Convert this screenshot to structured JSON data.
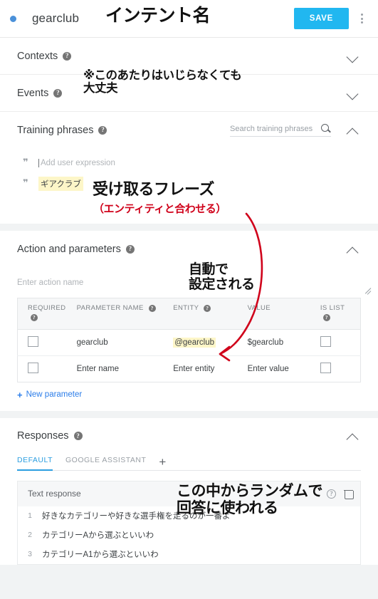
{
  "header": {
    "agent_name": "gearclub",
    "save_label": "SAVE",
    "dot_color": "#4a90d9",
    "save_color": "#21b7f0",
    "menu_icon": "more-vert-icon"
  },
  "sections": {
    "contexts": {
      "title": "Contexts",
      "chevron": "chevron-down-icon"
    },
    "events": {
      "title": "Events",
      "chevron": "chevron-down-icon"
    },
    "training_phrases": {
      "title": "Training phrases",
      "chevron": "chevron-up-icon",
      "search_placeholder": "Search training phrases",
      "search_value": "",
      "add_placeholder": "Add user expression",
      "phrases": [
        {
          "text": "ギアクラブ",
          "highlight": "#fdf6c8"
        }
      ]
    },
    "action_parameters": {
      "title": "Action and parameters",
      "chevron": "chevron-up-icon",
      "action_placeholder": "Enter action name",
      "action_value": "",
      "table": {
        "headers": [
          "REQUIRED",
          "PARAMETER NAME",
          "ENTITY",
          "VALUE",
          "IS LIST"
        ],
        "rows": [
          {
            "required": false,
            "name": "gearclub",
            "entity": "@gearclub",
            "value": "$gearclub",
            "is_list": false,
            "is_placeholder": false
          },
          {
            "required": false,
            "name": "Enter name",
            "entity": "Enter entity",
            "value": "Enter value",
            "is_list": false,
            "is_placeholder": true
          }
        ]
      },
      "new_parameter_label": "New parameter",
      "new_parameter_plus": "+"
    },
    "responses": {
      "title": "Responses",
      "chevron": "chevron-up-icon",
      "tabs": [
        {
          "label": "DEFAULT",
          "active": true
        },
        {
          "label": "GOOGLE ASSISTANT",
          "active": false
        }
      ],
      "add_tab": "+",
      "list_header": "Text response",
      "items": [
        {
          "num": "1",
          "text": "好きなカテゴリーや好きな選手権を走るのが一番よ"
        },
        {
          "num": "2",
          "text": "カテゴリーAから選ぶといいわ"
        },
        {
          "num": "3",
          "text": "カテゴリーA1から選ぶといいわ"
        }
      ]
    }
  },
  "annotations": {
    "title": "インテント名",
    "dont_touch": "※このあたりはいじらなくても\n大丈夫",
    "phrase": "受け取るフレーズ",
    "phrase_sub": "（エンティティと合わせる）",
    "auto_set": "自動で\n設定される",
    "random": "この中からランダムで\n回答に使われる",
    "arrow_color": "#d0021b"
  }
}
